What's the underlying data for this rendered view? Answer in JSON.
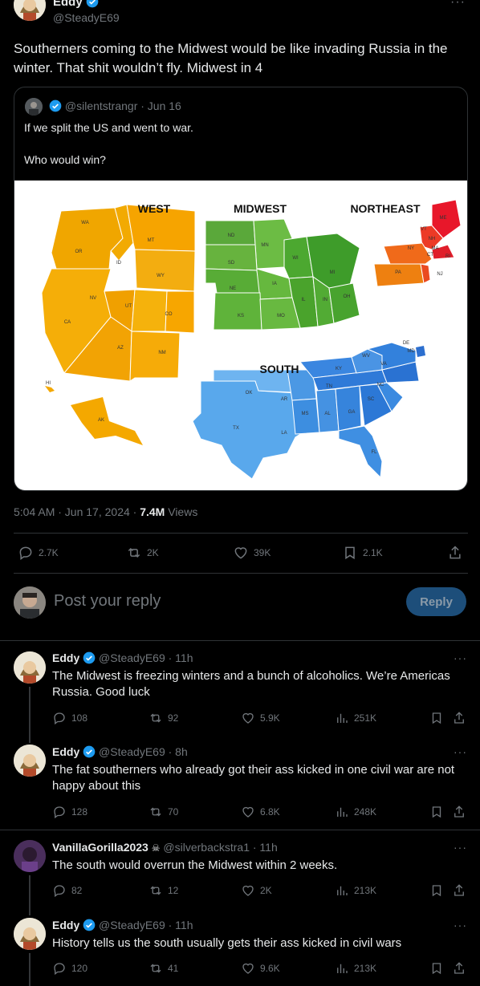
{
  "main": {
    "author_name": "Eddy",
    "author_handle": "@SteadyE69",
    "text": "Southerners coming to the Midwest would be like invading Russia in the winter. That shit wouldn’t fly. Midwest in 4",
    "quote": {
      "handle_time": "@silentstrangr · Jun 16",
      "text_line1": "If we split the US and went to war.",
      "text_line2": "Who would win?",
      "map": {
        "region_titles": [
          "WEST",
          "MIDWEST",
          "NORTHEAST",
          "SOUTH"
        ],
        "west_states": [
          "WA",
          "OR",
          "CA",
          "ID",
          "MT",
          "WY",
          "NV",
          "UT",
          "CO",
          "AZ",
          "NM",
          "AK",
          "HI"
        ],
        "midwest_states": [
          "ND",
          "MN",
          "SD",
          "WI",
          "MI",
          "NE",
          "IA",
          "IL",
          "IN",
          "OH",
          "KS",
          "MO"
        ],
        "northeast_states": [
          "ME",
          "VT",
          "NH",
          "MA",
          "RI",
          "CT",
          "NY",
          "PA",
          "NJ"
        ],
        "south_states": [
          "DE",
          "MD",
          "WV",
          "VA",
          "KY",
          "NC",
          "TN",
          "SC",
          "OK",
          "AR",
          "MS",
          "AL",
          "GA",
          "TX",
          "LA",
          "FL"
        ],
        "colors": {
          "west": "#f5a800",
          "midwest": "#5cb531",
          "northeast": "#f04e23",
          "south": "#3a86e0"
        }
      }
    },
    "time": "5:04 AM · Jun 17, 2024 · ",
    "views_count": "7.4M",
    "views_label": " Views",
    "stats": {
      "replies": "2.7K",
      "reposts": "2K",
      "likes": "39K",
      "bookmarks": "2.1K"
    }
  },
  "reply_box": {
    "placeholder": "Post your reply",
    "button": "Reply"
  },
  "replies": [
    {
      "name": "Eddy",
      "handle": "@SteadyE69 · 11h",
      "text": "The Midwest is freezing winters and a bunch of alcoholics. We’re Americas Russia. Good luck",
      "replies": "108",
      "reposts": "92",
      "likes": "5.9K",
      "views": "251K"
    },
    {
      "name": "Eddy",
      "handle": "@SteadyE69 · 8h",
      "text": "The fat southerners who already got their ass kicked in one civil war are not happy about this",
      "replies": "128",
      "reposts": "70",
      "likes": "6.8K",
      "views": "248K"
    },
    {
      "name": "VanillaGorilla2023",
      "handle": "@silverbackstra1 · 11h",
      "text": "The south would overrun the Midwest within 2 weeks.",
      "replies": "82",
      "reposts": "12",
      "likes": "2K",
      "views": "213K"
    },
    {
      "name": "Eddy",
      "handle": "@SteadyE69 · 11h",
      "text": "History tells us the south usually gets their ass kicked in civil wars",
      "replies": "120",
      "reposts": "41",
      "likes": "9.6K",
      "views": "213K"
    }
  ]
}
